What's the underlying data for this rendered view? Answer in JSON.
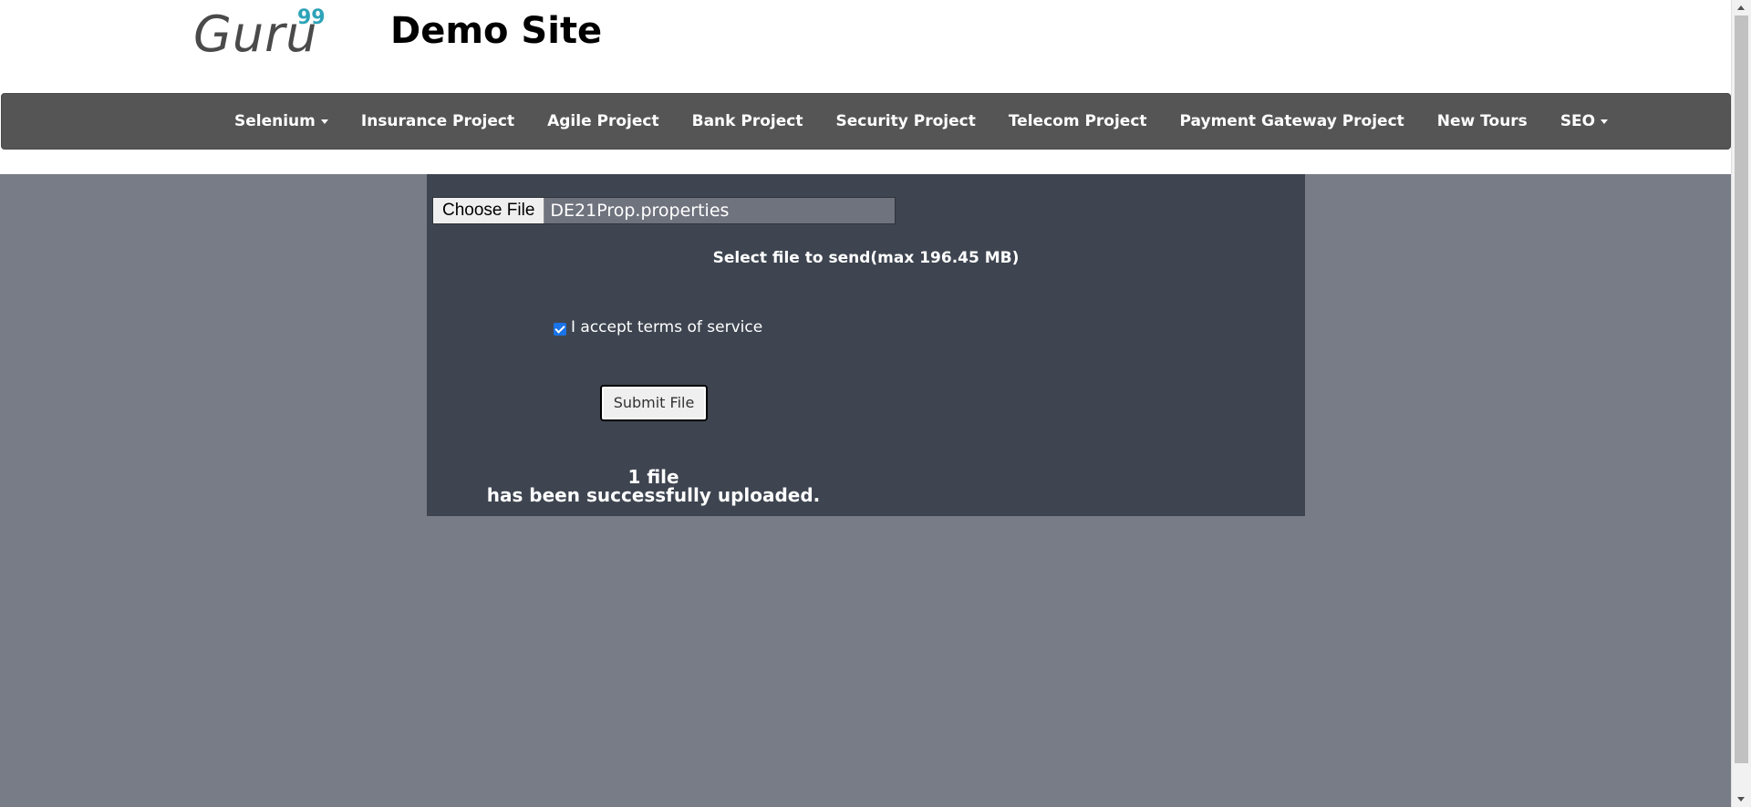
{
  "header": {
    "logo_text": "Guru",
    "logo_sup": "99",
    "site_title": "Demo Site"
  },
  "nav": {
    "items": [
      {
        "label": "Selenium",
        "dropdown": true
      },
      {
        "label": "Insurance Project",
        "dropdown": false
      },
      {
        "label": "Agile Project",
        "dropdown": false
      },
      {
        "label": "Bank Project",
        "dropdown": false
      },
      {
        "label": "Security Project",
        "dropdown": false
      },
      {
        "label": "Telecom Project",
        "dropdown": false
      },
      {
        "label": "Payment Gateway Project",
        "dropdown": false
      },
      {
        "label": "New Tours",
        "dropdown": false
      },
      {
        "label": "SEO",
        "dropdown": true
      }
    ]
  },
  "upload": {
    "choose_label": "Choose File",
    "file_name": "DE21Prop.properties",
    "select_text": "Select file to send(max 196.45 MB)",
    "terms_label": "I accept terms of service",
    "terms_checked": true,
    "submit_label": "Submit File",
    "success_line1": "1 file",
    "success_line2": "has been successfully uploaded."
  },
  "colors": {
    "navbar": "#555555",
    "content_bg": "#787c87",
    "panel": "#3e4550",
    "logo_accent": "#2ea3b8",
    "checkbox": "#1a73e8"
  }
}
